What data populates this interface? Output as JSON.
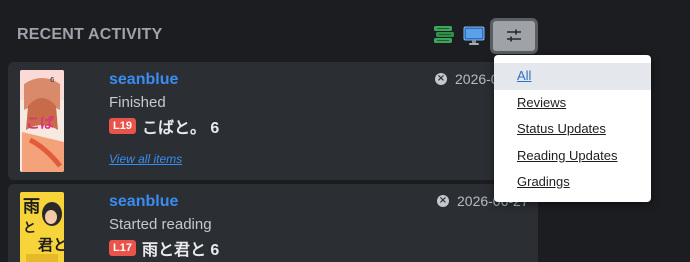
{
  "section": {
    "title": "RECENT ACTIVITY"
  },
  "toolbar": {
    "icons": [
      "books-stack-icon",
      "monitor-icon",
      "sliders-filter-icon"
    ]
  },
  "activities": [
    {
      "user": "seanblue",
      "action": "Finished",
      "level": "L19",
      "title": "こばと。 6",
      "view_all": "View all items",
      "date": "2026-0",
      "cover_icon": "manga-cover-kobato"
    },
    {
      "user": "seanblue",
      "action": "Started reading",
      "level": "L17",
      "title": "雨と君と 6",
      "date": "2026-06-27",
      "cover_icon": "manga-cover-ame-to-kimi-to"
    }
  ],
  "filter_menu": {
    "items": [
      "All",
      "Reviews",
      "Status Updates",
      "Reading Updates",
      "Gradings"
    ],
    "selected": "All"
  },
  "colors": {
    "background": "#1c1d20",
    "card": "#2b2e33",
    "link_blue": "#3a8df0",
    "level_badge": "#e8534a"
  }
}
